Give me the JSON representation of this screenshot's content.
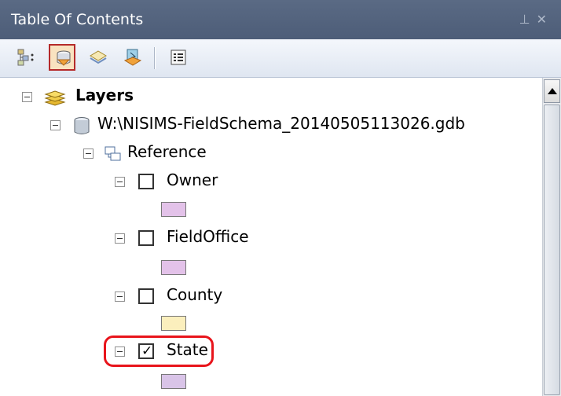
{
  "window": {
    "title": "Table Of Contents",
    "pin_glyph": "\u0004",
    "close_glyph": "×"
  },
  "toolbar": {
    "tools": [
      {
        "name": "list-by-drawing-order",
        "icon": "list-by-drawing-order-icon",
        "selected": false
      },
      {
        "name": "list-by-source",
        "icon": "list-by-source-icon",
        "selected": true
      },
      {
        "name": "list-by-visibility",
        "icon": "list-by-visibility-icon",
        "selected": false
      },
      {
        "name": "list-by-selection",
        "icon": "list-by-selection-icon",
        "selected": false
      },
      {
        "name": "options",
        "icon": "options-icon",
        "selected": false
      }
    ]
  },
  "tree": {
    "root": {
      "label": "Layers",
      "icon": "layers-icon"
    },
    "database": {
      "label": "W:\\NISIMS-FieldSchema_20140505113026.gdb",
      "icon": "geodatabase-icon"
    },
    "group": {
      "label": "Reference",
      "icon": "feature-dataset-icon"
    },
    "layers": [
      {
        "label": "Owner",
        "checked": false,
        "swatch_color": "#e3c2e9"
      },
      {
        "label": "FieldOffice",
        "checked": false,
        "swatch_color": "#e3c2e9"
      },
      {
        "label": "County",
        "checked": false,
        "swatch_color": "#fbefbd"
      },
      {
        "label": "State",
        "checked": true,
        "swatch_color": "#d9c4e8",
        "highlighted": true
      }
    ]
  },
  "scrollbar": {
    "up_arrow": "scroll-up-arrow"
  },
  "colors": {
    "highlight": "#e8141b",
    "titlebar": "#55647d",
    "selected_tool": "#b52a2a"
  }
}
